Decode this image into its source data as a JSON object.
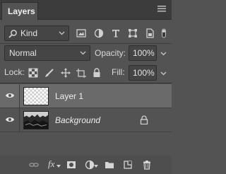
{
  "panel": {
    "tab_label": "Layers",
    "menu_icon": "hamburger-menu-icon"
  },
  "filter": {
    "kind_label": "Kind",
    "icons": [
      "image-filter-icon",
      "adjustment-filter-icon",
      "type-filter-icon",
      "shape-filter-icon",
      "smart-object-filter-icon",
      "filter-toggle-icon"
    ]
  },
  "blend": {
    "mode_label": "Normal",
    "opacity_label": "Opacity:",
    "opacity_value": "100%"
  },
  "lock": {
    "lock_label": "Lock:",
    "icons": [
      "lock-transparent-pixels-icon",
      "lock-image-pixels-icon",
      "lock-position-icon",
      "lock-artboard-icon",
      "lock-all-icon"
    ],
    "fill_label": "Fill:",
    "fill_value": "100%"
  },
  "layers": [
    {
      "name": "Layer 1",
      "visible": true,
      "selected": true,
      "locked": false
    },
    {
      "name": "Background",
      "visible": true,
      "selected": false,
      "locked": true
    }
  ],
  "bottom": {
    "fx_label": "fx",
    "icons": [
      "link-layers-icon",
      "add-layer-style-icon",
      "add-mask-icon",
      "new-adjustment-layer-icon",
      "new-group-icon",
      "new-layer-icon",
      "delete-layer-icon"
    ]
  }
}
